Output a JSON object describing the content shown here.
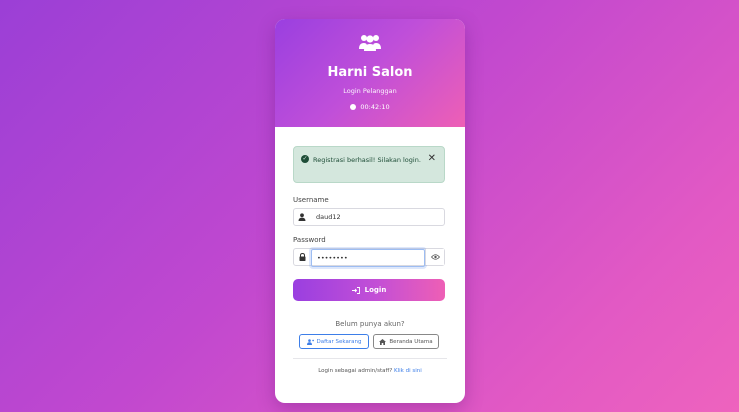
{
  "header": {
    "brand": "Harni Salon",
    "subtitle": "Login Pelanggan",
    "time": "00:42:10"
  },
  "alert": {
    "message": "Registrasi berhasil! Silakan login.",
    "type": "success"
  },
  "form": {
    "username_label": "Username",
    "username_value": "daud12",
    "password_label": "Password",
    "password_value": "••••••••",
    "login_label": "Login"
  },
  "register": {
    "question": "Belum punya akun?",
    "daftar_label": "Daftar Sekarang",
    "beranda_label": "Beranda Utama"
  },
  "admin": {
    "text": "Login sebagai admin/staff?",
    "link": "Klik di sini"
  },
  "colors": {
    "accent_start": "#9a3fe0",
    "accent_end": "#ee5fb5",
    "link": "#3d7ee8",
    "success_bg": "#d4e7dd"
  }
}
